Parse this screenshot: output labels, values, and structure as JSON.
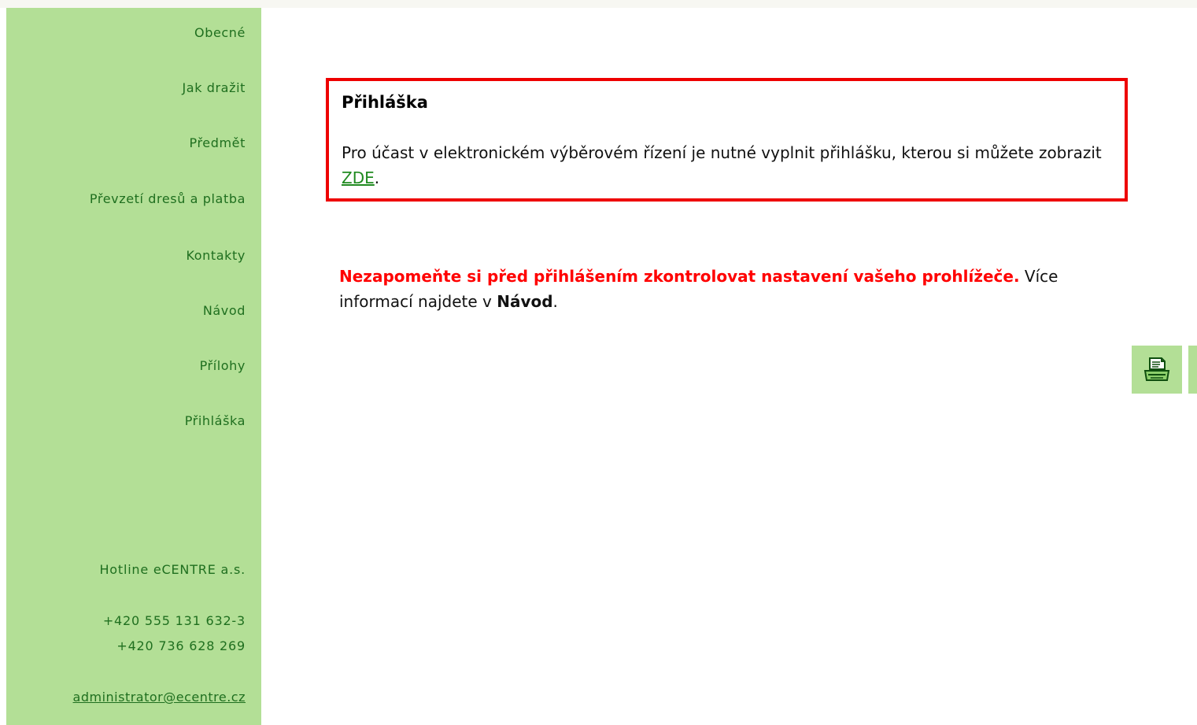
{
  "sidebar": {
    "items": [
      {
        "label": "Obecné"
      },
      {
        "label": "Jak dražit"
      },
      {
        "label": "Předmět"
      },
      {
        "label": "Převzetí dresů a platba"
      },
      {
        "label": "Kontakty"
      },
      {
        "label": "Návod"
      },
      {
        "label": "Přílohy"
      },
      {
        "label": "Přihláška"
      }
    ],
    "hotline": {
      "label": "Hotline eCENTRE a.s.",
      "phone1": "+420 555 131 632-3",
      "phone2": "+420 736 628 269",
      "email": "administrator@ecentre.cz"
    }
  },
  "notice": {
    "title": "Přihláška",
    "body_before": "Pro účast v elektronickém výběrovém řízení je nutné vyplnit přihlášku, kterou si můžete zobrazit ",
    "link": "ZDE",
    "body_after": "."
  },
  "warning": {
    "red_text": "Nezapomeňte si před přihlášením zkontrolovat nastavení vašeho prohlížeče.",
    "text_before": " Více informací najdete v ",
    "bold_text": "Návod",
    "text_after": "."
  },
  "icons": {
    "print": "printer-icon"
  },
  "colors": {
    "sidebar_bg": "#b3df96",
    "link": "#1f6f1f",
    "alert": "#ff0000"
  }
}
